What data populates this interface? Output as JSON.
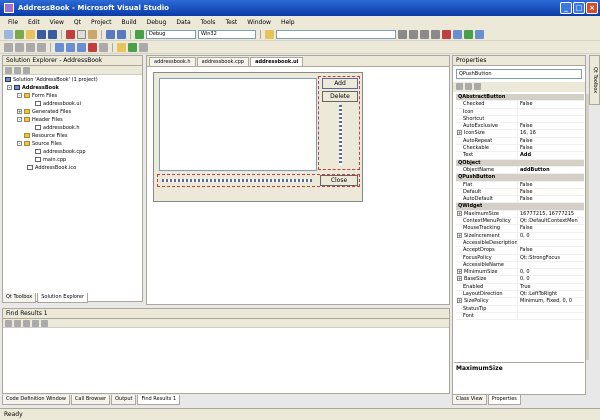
{
  "window": {
    "title": "AddressBook - Microsoft Visual Studio"
  },
  "menu": [
    "File",
    "Edit",
    "View",
    "Qt",
    "Project",
    "Build",
    "Debug",
    "Data",
    "Tools",
    "Test",
    "Window",
    "Help"
  ],
  "toolbar": {
    "config": "Debug",
    "platform": "Win32"
  },
  "solution_explorer": {
    "title": "Solution Explorer - AddressBook",
    "items": [
      {
        "label": "Solution 'AddressBook' (1 project)"
      },
      {
        "label": "AddressBook"
      },
      {
        "label": "Form Files"
      },
      {
        "label": "addressbook.ui"
      },
      {
        "label": "Generated Files"
      },
      {
        "label": "Header Files"
      },
      {
        "label": "addressbook.h"
      },
      {
        "label": "Resource Files"
      },
      {
        "label": "Source Files"
      },
      {
        "label": "addressbook.cpp"
      },
      {
        "label": "main.cpp"
      },
      {
        "label": "AddressBook.ico"
      }
    ],
    "tabs": [
      "Qt Toolbox",
      "Solution Explorer"
    ]
  },
  "editor": {
    "tabs": [
      "addressbook.h",
      "addressbook.cpp",
      "addressbook.ui"
    ],
    "form": {
      "add_label": "Add",
      "delete_label": "Delete",
      "close_label": "Close"
    }
  },
  "properties": {
    "title": "Properties",
    "object": "QPushButton",
    "rows": [
      {
        "group": "QAbstractButton"
      },
      {
        "k": "Checked",
        "v": "False"
      },
      {
        "k": "Icon",
        "v": ""
      },
      {
        "k": "Shortcut",
        "v": ""
      },
      {
        "k": "AutoExclusive",
        "v": "False"
      },
      {
        "k": "IconSize",
        "v": "16, 16",
        "plus": true
      },
      {
        "k": "AutoRepeat",
        "v": "False"
      },
      {
        "k": "Checkable",
        "v": "False"
      },
      {
        "k": "Text",
        "v": "Add",
        "bold": true
      },
      {
        "group": "QObject"
      },
      {
        "k": "ObjectName",
        "v": "addButton",
        "bold": true
      },
      {
        "group": "QPushButton"
      },
      {
        "k": "Flat",
        "v": "False"
      },
      {
        "k": "Default",
        "v": "False"
      },
      {
        "k": "AutoDefault",
        "v": "False"
      },
      {
        "group": "QWidget"
      },
      {
        "k": "MaximumSize",
        "v": "16777215, 16777215",
        "plus": true
      },
      {
        "k": "ContextMenuPolicy",
        "v": "Qt::DefaultContextMen"
      },
      {
        "k": "MouseTracking",
        "v": "False"
      },
      {
        "k": "SizeIncrement",
        "v": "0, 0",
        "plus": true
      },
      {
        "k": "AccessibleDescription",
        "v": ""
      },
      {
        "k": "AcceptDrops",
        "v": "False"
      },
      {
        "k": "FocusPolicy",
        "v": "Qt::StrongFocus"
      },
      {
        "k": "AccessibleName",
        "v": ""
      },
      {
        "k": "MinimumSize",
        "v": "0, 0",
        "plus": true
      },
      {
        "k": "BaseSize",
        "v": "0, 0",
        "plus": true
      },
      {
        "k": "Enabled",
        "v": "True"
      },
      {
        "k": "LayoutDirection",
        "v": "Qt::LeftToRight"
      },
      {
        "k": "SizePolicy",
        "v": "Minimum, Fixed, 0, 0",
        "plus": true
      },
      {
        "k": "StatusTip",
        "v": ""
      },
      {
        "k": "Font",
        "v": ""
      }
    ],
    "description": "MaximumSize",
    "tabs": [
      "Class View",
      "Properties"
    ]
  },
  "right_strip": "Qt Toolbox",
  "find_results": {
    "title": "Find Results 1"
  },
  "bottom_tabs": [
    "Code Definition Window",
    "Call Browser",
    "Output",
    "Find Results 1"
  ],
  "status": "Ready"
}
